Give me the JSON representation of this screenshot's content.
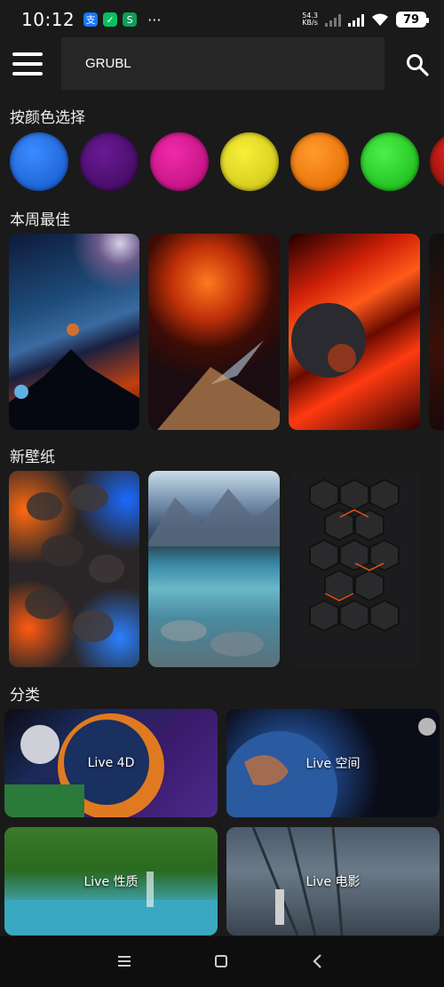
{
  "status_bar": {
    "time": "10:12",
    "network_speed": "54.3",
    "network_unit": "KB/s",
    "battery": "79",
    "apps": [
      "支",
      "✓",
      "S"
    ],
    "more": "···"
  },
  "header": {
    "menu_icon": "hamburger-menu-icon",
    "search_value": "GRUBL",
    "search_icon": "search-icon"
  },
  "sections": {
    "by_color": "按颜色选择",
    "weekly_best": "本周最佳",
    "new_wallpapers": "新壁纸",
    "categories": "分类"
  },
  "colors": [
    "#1e6fe0",
    "#4b0f6e",
    "#d4138f",
    "#e8e020",
    "#f57a0b",
    "#1fd11a",
    "#b0140f"
  ],
  "categories": [
    {
      "label": "Live 4D"
    },
    {
      "label": "Live 空间"
    },
    {
      "label": "Live 性质"
    },
    {
      "label": "Live 电影"
    }
  ],
  "nav": {
    "recent_icon": "menu-lines-icon",
    "home_icon": "square-home-icon",
    "back_icon": "back-chevron-icon"
  }
}
